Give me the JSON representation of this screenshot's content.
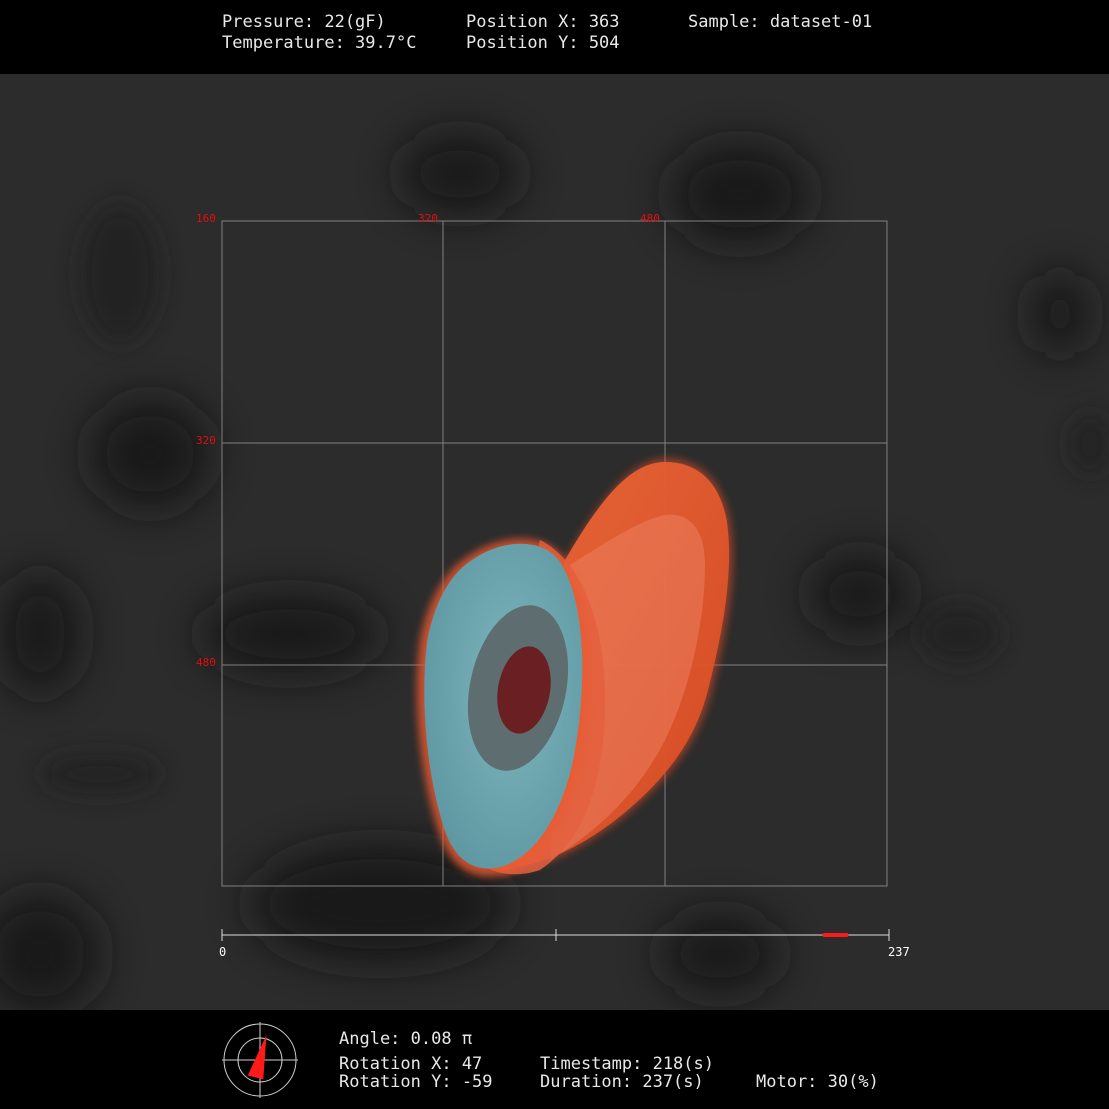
{
  "header": {
    "pressure": "Pressure: 22(gF)",
    "temperature": "Temperature: 39.7°C",
    "position_x": "Position X: 363",
    "position_y": "Position Y: 504",
    "sample": "Sample: dataset-01"
  },
  "grid": {
    "top_labels": [
      "160",
      "320",
      "480"
    ],
    "left_labels": [
      "320",
      "480"
    ]
  },
  "timeline": {
    "start_label": "0",
    "end_label": "237",
    "min": 0,
    "max": 237,
    "current": 218
  },
  "footer": {
    "angle": "Angle: 0.08 π",
    "rotation_x": "Rotation X: 47",
    "rotation_y": "Rotation Y: -59",
    "timestamp": "Timestamp: 218(s)",
    "duration": "Duration: 237(s)",
    "motor": "Motor: 30(%)"
  },
  "compass": {
    "angle_pi": 0.08
  },
  "colors": {
    "accent": "#ff1a1a",
    "specimen_outer": "#e8542a",
    "specimen_face": "#6aa3ad",
    "specimen_inner": "#5b6a6c",
    "specimen_core": "#6a1f22",
    "grid_line": "#8a8a8a"
  }
}
